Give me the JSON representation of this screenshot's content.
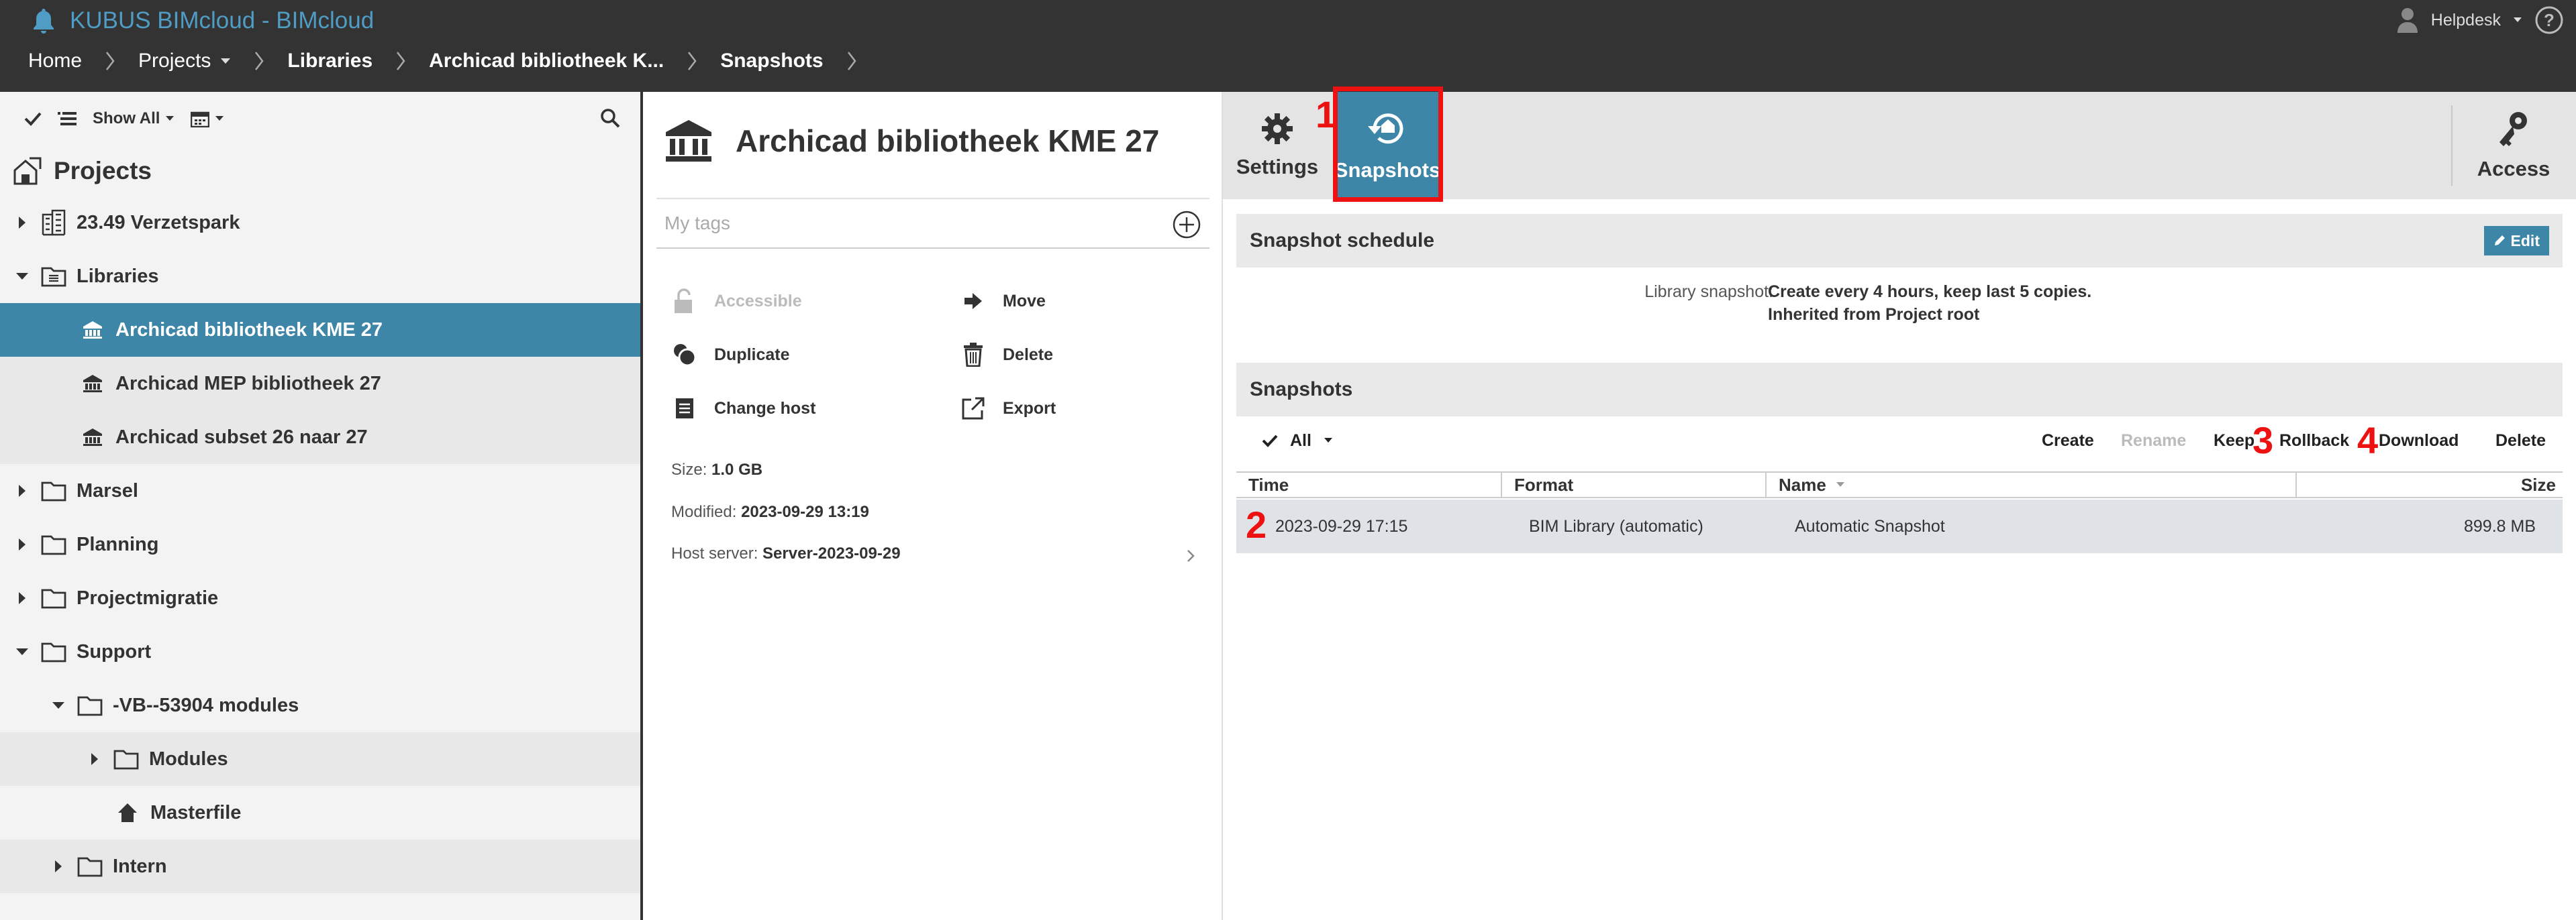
{
  "app": {
    "title": "KUBUS BIMcloud - BIMcloud",
    "user": "Helpdesk"
  },
  "breadcrumb": [
    "Home",
    "Projects",
    "Libraries",
    "Archicad bibliotheek K...",
    "Snapshots"
  ],
  "tree": {
    "toolbar": {
      "filter_label": "Show All"
    },
    "title": "Projects",
    "items": [
      "23.49 Verzetspark",
      "Libraries",
      "Archicad bibliotheek KME 27",
      "Archicad MEP bibliotheek 27",
      "Archicad subset 26 naar 27",
      "Marsel",
      "Planning",
      "Projectmigratie",
      "Support",
      "-VB--53904 modules",
      "Modules",
      "Masterfile",
      "Intern"
    ]
  },
  "detail": {
    "title": "Archicad bibliotheek KME 27",
    "tags_placeholder": "My tags",
    "actions": {
      "accessible": "Accessible",
      "move": "Move",
      "duplicate": "Duplicate",
      "delete": "Delete",
      "change_host": "Change host",
      "export": "Export"
    },
    "size_label": "Size:",
    "size_value": "1.0 GB",
    "modified_label": "Modified:",
    "modified_value": "2023-09-29 13:19",
    "host_label": "Host server:",
    "host_value": "Server-2023-09-29"
  },
  "tabs": {
    "settings": "Settings",
    "snapshots": "Snapshots",
    "access": "Access"
  },
  "markers": [
    "1",
    "2",
    "3",
    "4"
  ],
  "schedule": {
    "title": "Snapshot schedule",
    "edit": "Edit",
    "label": "Library snapshot:",
    "line1": "Create every 4 hours, keep last 5 copies.",
    "line2": "Inherited from Project root"
  },
  "snapshots": {
    "title": "Snapshots",
    "filter": "All",
    "toolbar": {
      "create": "Create",
      "rename": "Rename",
      "keep": "Keep",
      "rollback": "Rollback",
      "download": "Download",
      "delete": "Delete"
    },
    "columns": [
      "Time",
      "Format",
      "Name",
      "Size"
    ],
    "rows": [
      {
        "time": "2023-09-29 17:15",
        "format": "BIM Library (automatic)",
        "name": "Automatic Snapshot",
        "size": "899.8 MB"
      }
    ]
  },
  "colors": {
    "topbar": "#333333",
    "accent": "#3e86a8",
    "title_blue": "#4f9cc4",
    "marker_red": "#ee1111"
  }
}
